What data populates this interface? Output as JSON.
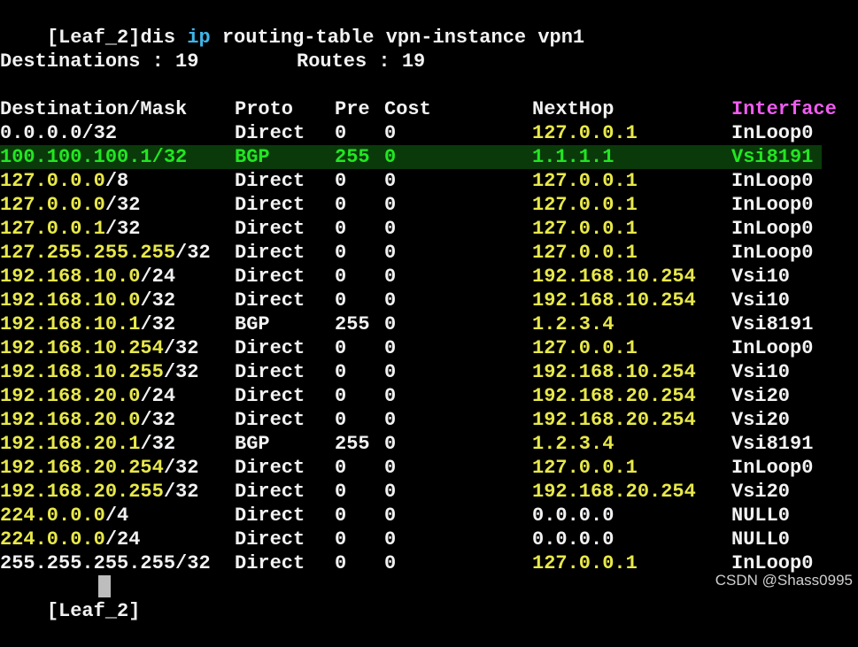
{
  "terminal": {
    "prompt_host": "[Leaf_2]",
    "command_pre": "dis ",
    "command_kw": "ip",
    "command_post": " routing-table vpn-instance vpn1",
    "summary": {
      "destinations_label": "Destinations : 19",
      "routes_label": "Routes : 19"
    },
    "headers": {
      "dest": "Destination/Mask",
      "proto": "Proto",
      "pre": "Pre",
      "cost": "Cost",
      "nexthop": "NextHop",
      "interface": "Interface"
    },
    "rows": [
      {
        "ip": "0.0.0.0",
        "mask": "/32",
        "proto": "Direct",
        "pre": "0",
        "cost": "0",
        "nexthop": "127.0.0.1",
        "iface": "InLoop0"
      },
      {
        "ip": "100.100.100.1",
        "mask": "/32",
        "proto": "BGP",
        "pre": "255",
        "cost": "0",
        "nexthop": "1.1.1.1",
        "iface": "Vsi8191"
      },
      {
        "ip": "127.0.0.0",
        "mask": "/8",
        "proto": "Direct",
        "pre": "0",
        "cost": "0",
        "nexthop": "127.0.0.1",
        "iface": "InLoop0"
      },
      {
        "ip": "127.0.0.0",
        "mask": "/32",
        "proto": "Direct",
        "pre": "0",
        "cost": "0",
        "nexthop": "127.0.0.1",
        "iface": "InLoop0"
      },
      {
        "ip": "127.0.0.1",
        "mask": "/32",
        "proto": "Direct",
        "pre": "0",
        "cost": "0",
        "nexthop": "127.0.0.1",
        "iface": "InLoop0"
      },
      {
        "ip": "127.255.255.255",
        "mask": "/32",
        "proto": "Direct",
        "pre": "0",
        "cost": "0",
        "nexthop": "127.0.0.1",
        "iface": "InLoop0"
      },
      {
        "ip": "192.168.10.0",
        "mask": "/24",
        "proto": "Direct",
        "pre": "0",
        "cost": "0",
        "nexthop": "192.168.10.254",
        "iface": "Vsi10"
      },
      {
        "ip": "192.168.10.0",
        "mask": "/32",
        "proto": "Direct",
        "pre": "0",
        "cost": "0",
        "nexthop": "192.168.10.254",
        "iface": "Vsi10"
      },
      {
        "ip": "192.168.10.1",
        "mask": "/32",
        "proto": "BGP",
        "pre": "255",
        "cost": "0",
        "nexthop": "1.2.3.4",
        "iface": "Vsi8191"
      },
      {
        "ip": "192.168.10.254",
        "mask": "/32",
        "proto": "Direct",
        "pre": "0",
        "cost": "0",
        "nexthop": "127.0.0.1",
        "iface": "InLoop0"
      },
      {
        "ip": "192.168.10.255",
        "mask": "/32",
        "proto": "Direct",
        "pre": "0",
        "cost": "0",
        "nexthop": "192.168.10.254",
        "iface": "Vsi10"
      },
      {
        "ip": "192.168.20.0",
        "mask": "/24",
        "proto": "Direct",
        "pre": "0",
        "cost": "0",
        "nexthop": "192.168.20.254",
        "iface": "Vsi20"
      },
      {
        "ip": "192.168.20.0",
        "mask": "/32",
        "proto": "Direct",
        "pre": "0",
        "cost": "0",
        "nexthop": "192.168.20.254",
        "iface": "Vsi20"
      },
      {
        "ip": "192.168.20.1",
        "mask": "/32",
        "proto": "BGP",
        "pre": "255",
        "cost": "0",
        "nexthop": "1.2.3.4",
        "iface": "Vsi8191"
      },
      {
        "ip": "192.168.20.254",
        "mask": "/32",
        "proto": "Direct",
        "pre": "0",
        "cost": "0",
        "nexthop": "127.0.0.1",
        "iface": "InLoop0"
      },
      {
        "ip": "192.168.20.255",
        "mask": "/32",
        "proto": "Direct",
        "pre": "0",
        "cost": "0",
        "nexthop": "192.168.20.254",
        "iface": "Vsi20"
      },
      {
        "ip": "224.0.0.0",
        "mask": "/4",
        "proto": "Direct",
        "pre": "0",
        "cost": "0",
        "nexthop": "0.0.0.0",
        "iface": "NULL0"
      },
      {
        "ip": "224.0.0.0",
        "mask": "/24",
        "proto": "Direct",
        "pre": "0",
        "cost": "0",
        "nexthop": "0.0.0.0",
        "iface": "NULL0"
      },
      {
        "ip": "255.255.255.255",
        "mask": "/32",
        "proto": "Direct",
        "pre": "0",
        "cost": "0",
        "nexthop": "127.0.0.1",
        "iface": "InLoop0"
      }
    ],
    "final_prompt": "[Leaf_2]"
  },
  "watermark": "CSDN @Shass0995",
  "colors": {
    "background": "#000000",
    "text": "#f2f2f2",
    "ip_yellow": "#e8e84a",
    "highlight_green": "#22e622",
    "highlight_bg": "#0a3a0a",
    "keyword_cyan": "#3fb5e8",
    "header_magenta": "#f05cf0"
  }
}
